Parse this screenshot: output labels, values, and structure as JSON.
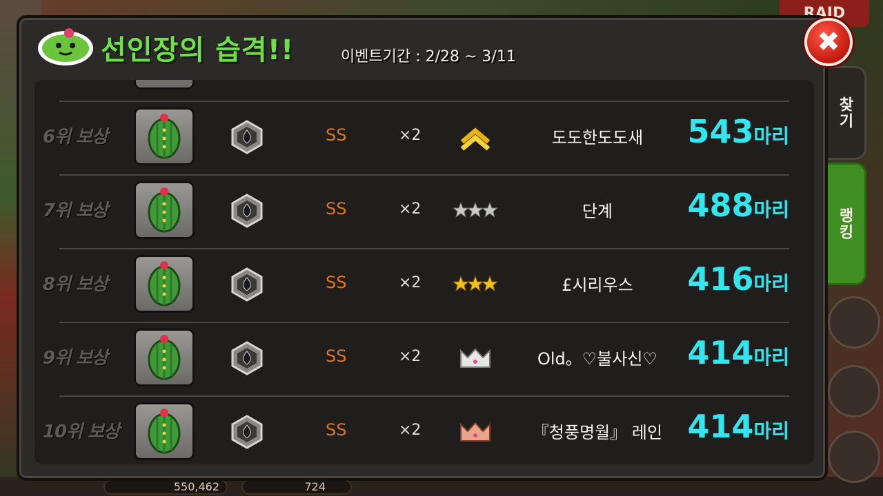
{
  "background": {
    "raid_label": "RAID",
    "gold_amount": "550,462",
    "gem_amount": "724"
  },
  "side_tabs": {
    "find_label": "찾기",
    "ranking_label": "랭킹"
  },
  "header": {
    "title": "선인장의 습격!!",
    "event_period": "이벤트기간 : 2/28 ~ 3/11",
    "close_symbol": "✖"
  },
  "colors": {
    "title": "#6fe04a",
    "score": "#33e6ee",
    "grade": "#e07420",
    "active_tab": "#3f8f22"
  },
  "rows": [
    {
      "rank": "6위 보상",
      "reward_icon": "cactus-icon",
      "item_icon": "hexagon-gem-icon",
      "grade": "SS",
      "qty": "×2",
      "badge": "double-chevron-gold-icon",
      "player": "도도한도도새",
      "score": "543",
      "unit": "마리"
    },
    {
      "rank": "7위 보상",
      "reward_icon": "cactus-icon",
      "item_icon": "hexagon-gem-icon",
      "grade": "SS",
      "qty": "×2",
      "badge": "three-silver-stars-icon",
      "player": "단계",
      "score": "488",
      "unit": "마리"
    },
    {
      "rank": "8위 보상",
      "reward_icon": "cactus-icon",
      "item_icon": "hexagon-gem-icon",
      "grade": "SS",
      "qty": "×2",
      "badge": "three-gold-stars-icon",
      "player": "£시리우스",
      "score": "416",
      "unit": "마리"
    },
    {
      "rank": "9위 보상",
      "reward_icon": "cactus-icon",
      "item_icon": "hexagon-gem-icon",
      "grade": "SS",
      "qty": "×2",
      "badge": "silver-crown-icon",
      "player": "Old。♡불사신♡",
      "score": "414",
      "unit": "마리"
    },
    {
      "rank": "10위 보상",
      "reward_icon": "cactus-icon",
      "item_icon": "hexagon-gem-icon",
      "grade": "SS",
      "qty": "×2",
      "badge": "bronze-crown-icon",
      "player": "『청풍명월』 레인",
      "score": "414",
      "unit": "마리"
    }
  ]
}
